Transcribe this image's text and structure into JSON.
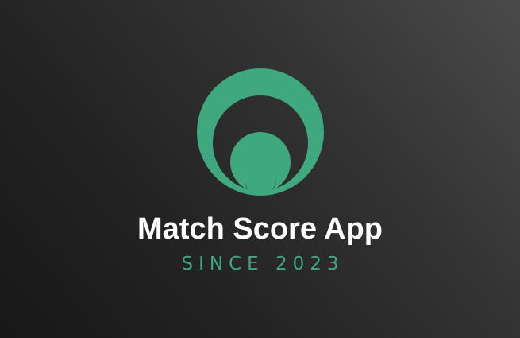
{
  "brand": {
    "title": "Match Score App",
    "tagline": "SINCE 2023",
    "logo_icon": "nested-circles-logo-icon"
  },
  "colors": {
    "accent": "#3fa87f",
    "background_light": "#4a4a4a",
    "background_dark": "#181818",
    "title_text": "#ffffff"
  }
}
